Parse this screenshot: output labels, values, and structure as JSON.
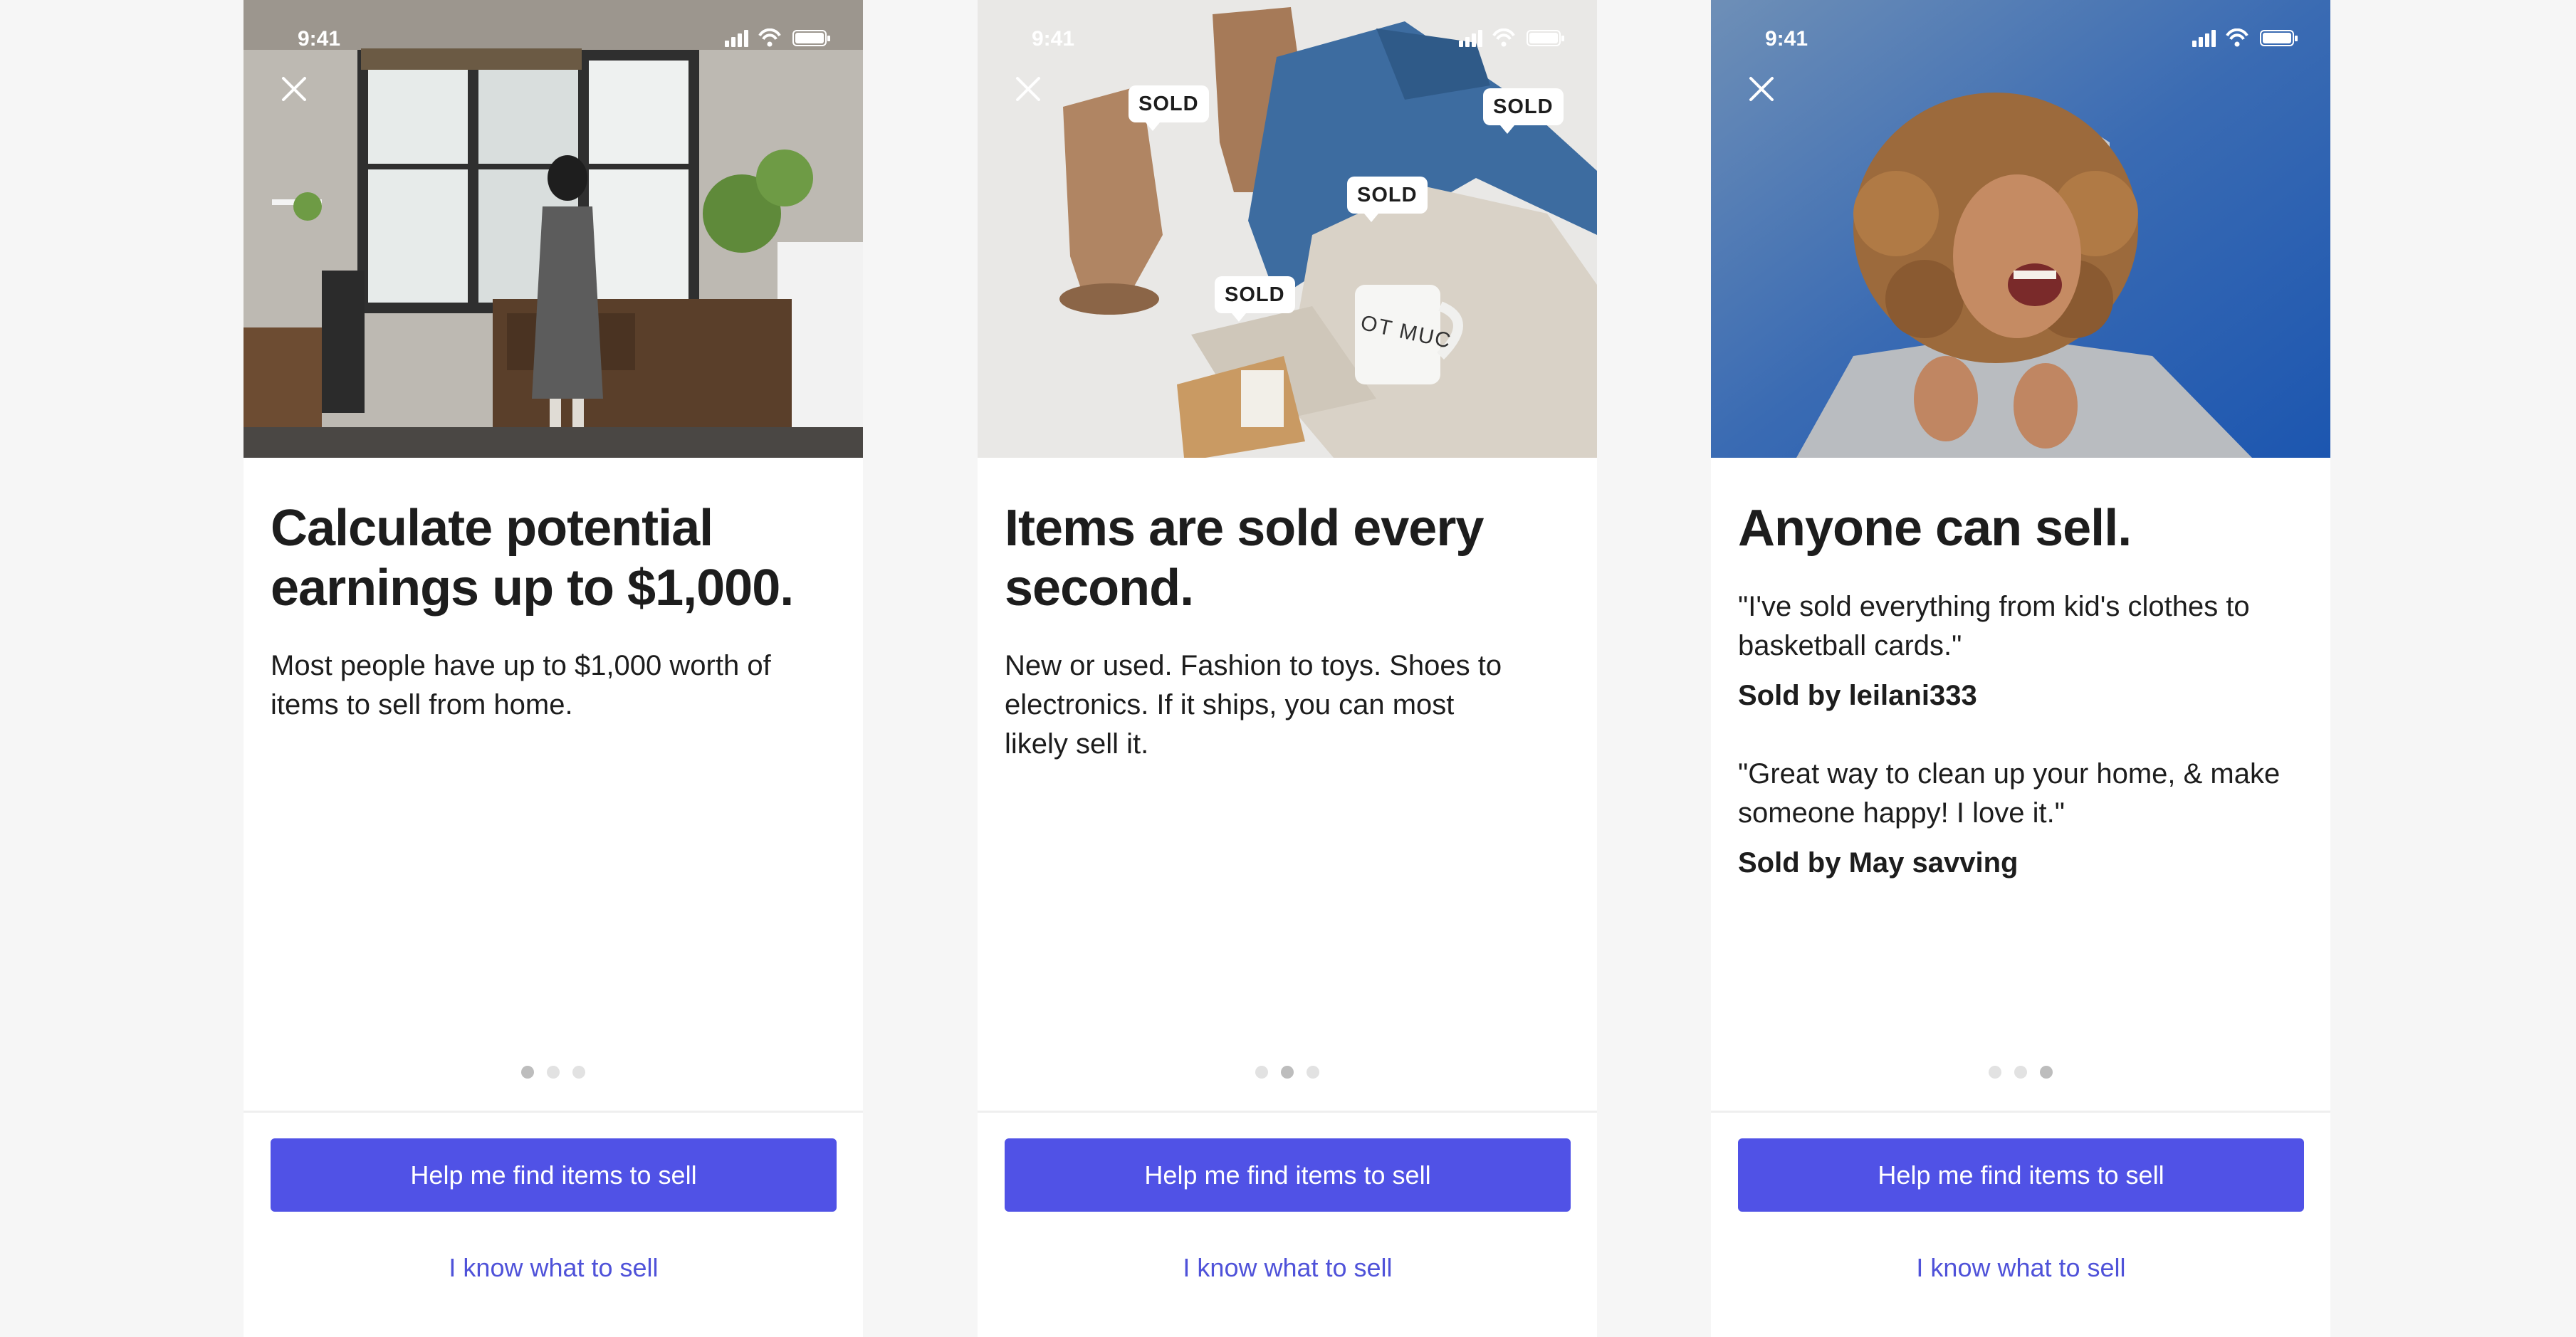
{
  "status_bar": {
    "time": "9:41"
  },
  "screens": [
    {
      "title": "Calculate potential earnings up to $1,000.",
      "body": "Most people have up to $1,000 worth of items to sell from home.",
      "primary_button": "Help me find items to sell",
      "secondary_link": "I know what to sell",
      "active_dot": 1
    },
    {
      "title": "Items are sold every second.",
      "body": "New or used. Fashion to toys. Shoes to electronics. If it ships, you can most likely sell it.",
      "sold_labels": [
        "SOLD",
        "SOLD",
        "SOLD",
        "SOLD"
      ],
      "mug_text": "OT MUC",
      "primary_button": "Help me find items to sell",
      "secondary_link": "I know what to sell",
      "active_dot": 2
    },
    {
      "title": "Anyone can sell.",
      "testimonials": [
        {
          "quote": "\"I've sold everything from kid's clothes to basketball cards.\"",
          "seller": "Sold by leilani333"
        },
        {
          "quote": "\"Great way to clean up your home, & make someone happy! I love it.\"",
          "seller": "Sold by May savving"
        }
      ],
      "primary_button": "Help me find items to sell",
      "secondary_link": "I know what to sell",
      "active_dot": 3
    }
  ],
  "colors": {
    "primary": "#5052e6",
    "link": "#4f52d9",
    "background": "#f6f6f6"
  }
}
